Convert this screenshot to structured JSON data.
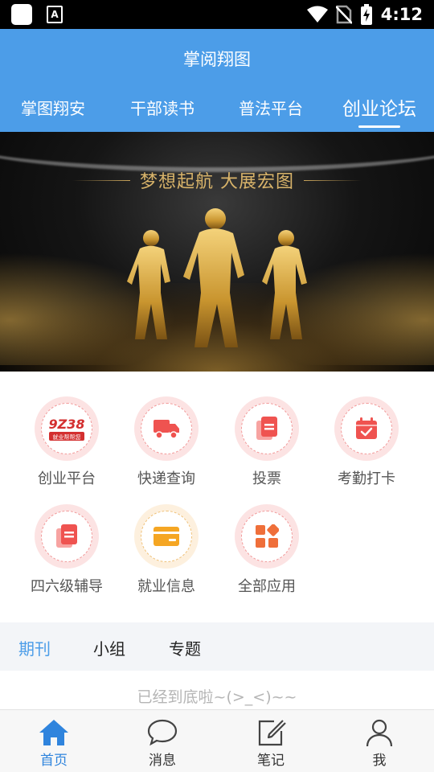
{
  "status_bar": {
    "time": "4:12",
    "icons": [
      "app-square-icon",
      "text-a-icon",
      "wifi-icon",
      "no-sim-icon",
      "battery-charging-icon"
    ],
    "text_icon_letter": "A"
  },
  "header": {
    "title": "掌阅翔图",
    "tabs": [
      {
        "label": "掌图翔安",
        "active": false
      },
      {
        "label": "干部读书",
        "active": false
      },
      {
        "label": "普法平台",
        "active": false
      },
      {
        "label": "创业论坛",
        "active": true
      }
    ]
  },
  "banner": {
    "slogan": "梦想起航  大展宏图"
  },
  "apps": [
    {
      "label": "创业平台",
      "icon": "jobs-logo-icon",
      "logo_text": "就业帮帮您"
    },
    {
      "label": "快递查询",
      "icon": "truck-icon"
    },
    {
      "label": "投票",
      "icon": "document-copy-icon"
    },
    {
      "label": "考勤打卡",
      "icon": "calendar-check-icon"
    },
    {
      "label": "四六级辅导",
      "icon": "document-copy-icon"
    },
    {
      "label": "就业信息",
      "icon": "wallet-card-icon"
    },
    {
      "label": "全部应用",
      "icon": "apps-grid-icon"
    }
  ],
  "section_tabs": [
    {
      "label": "期刊",
      "active": true
    },
    {
      "label": "小组",
      "active": false
    },
    {
      "label": "专题",
      "active": false
    }
  ],
  "end_text": "已经到底啦~(>_<)~~",
  "bottom_nav": [
    {
      "label": "首页",
      "icon": "home-icon",
      "active": true
    },
    {
      "label": "消息",
      "icon": "chat-bubble-icon",
      "active": false
    },
    {
      "label": "笔记",
      "icon": "edit-note-icon",
      "active": false
    },
    {
      "label": "我",
      "icon": "user-icon",
      "active": false
    }
  ],
  "colors": {
    "primary": "#4c9de8",
    "active_nav": "#2f84dd",
    "icon_red": "#ef5350",
    "icon_orange": "#f5a623",
    "banner_gold": "#d9b46a"
  }
}
